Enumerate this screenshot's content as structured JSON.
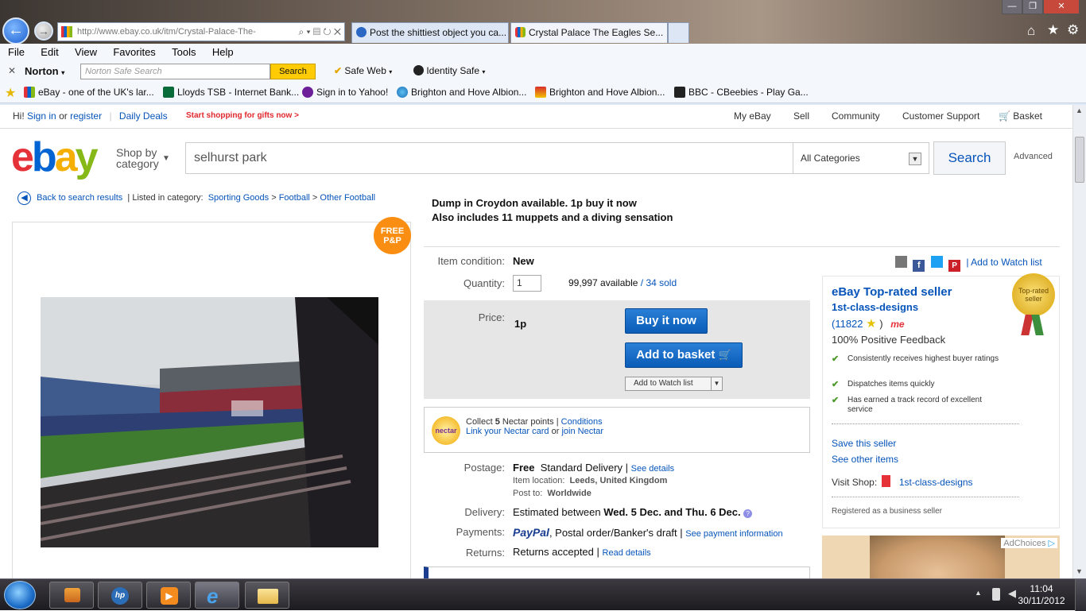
{
  "browser": {
    "address": "http://www.ebay.co.uk/itm/Crystal-Palace-The-",
    "tabs": [
      {
        "title": "Post the shittiest object you ca..."
      },
      {
        "title": "Crystal Palace The Eagles Se..."
      }
    ],
    "menu": [
      "File",
      "Edit",
      "View",
      "Favorites",
      "Tools",
      "Help"
    ],
    "norton": {
      "brand": "Norton",
      "search_placeholder": "Norton Safe Search",
      "search_label": "Search",
      "safe_web": "Safe Web",
      "identity_safe": "Identity Safe"
    },
    "favorites": [
      "eBay - one of the UK's lar...",
      "Lloyds TSB - Internet Bank...",
      "Sign in to Yahoo!",
      "Brighton and Hove Albion...",
      "Brighton and Hove Albion...",
      "BBC - CBeebies - Play Ga..."
    ]
  },
  "topbar": {
    "greeting": "Hi!",
    "sign_in": "Sign in",
    "or": "or",
    "register": "register",
    "daily_deals": "Daily Deals",
    "promo": "Start shopping for gifts now >",
    "my_ebay": "My eBay",
    "sell": "Sell",
    "community": "Community",
    "customer_support": "Customer Support",
    "basket": "Basket"
  },
  "header": {
    "shop_by": "Shop by",
    "category": "category",
    "search_value": "selhurst park",
    "all_categories": "All Categories",
    "search_button": "Search",
    "advanced": "Advanced"
  },
  "breadcrumb": {
    "back": "Back to search results",
    "listed_in": "| Listed in category:",
    "items": [
      "Sporting Goods",
      "Football",
      "Other Football"
    ]
  },
  "badge": {
    "line1": "FREE",
    "line2": "P&P"
  },
  "item": {
    "title_line1": "Dump in Croydon available. 1p buy it now",
    "title_line2": "Also includes 11 muppets and a diving sensation",
    "condition_label": "Item condition:",
    "condition": "New",
    "quantity_label": "Quantity:",
    "quantity": "1",
    "available": "99,997 available",
    "sold": "34 sold",
    "price_label": "Price:",
    "price": "1p",
    "buy_now": "Buy it now",
    "add_to_basket": "Add to basket",
    "add_watch": "Add to Watch list"
  },
  "nectar": {
    "logo": "nectar",
    "collect_prefix": "Collect",
    "points": "5",
    "collect_suffix": "Nectar points |",
    "conditions": "Conditions",
    "link_card": "Link your Nectar card",
    "or": "or",
    "join": "join Nectar"
  },
  "shipping": {
    "postage_label": "Postage:",
    "postage": "Free",
    "postage_type": "Standard Delivery |",
    "see_details": "See details",
    "item_location_label": "Item location:",
    "item_location": "Leeds, United Kingdom",
    "post_to_label": "Post to:",
    "post_to": "Worldwide",
    "delivery_label": "Delivery:",
    "delivery_prefix": "Estimated between",
    "delivery_dates": "Wed. 5 Dec. and Thu. 6 Dec.",
    "payments_label": "Payments:",
    "paypal": "PayPal",
    "payments_other": ", Postal order/Banker's draft |",
    "see_payment": "See payment information",
    "returns_label": "Returns:",
    "returns": "Returns accepted |",
    "read_details": "Read details"
  },
  "social": {
    "add_watch": "| Add to Watch list"
  },
  "seller": {
    "heading": "eBay Top-rated seller",
    "name": "1st-class-designs",
    "feedback_count": "(11822",
    "feedback_close": ")",
    "me_badge": "me",
    "positive": "100% Positive Feedback",
    "seal": "Top-rated seller",
    "checks": [
      "Consistently receives highest buyer ratings",
      "Dispatches items quickly",
      "Has earned a track record of excellent service"
    ],
    "save_seller": "Save this seller",
    "see_other": "See other items",
    "visit_shop_label": "Visit Shop:",
    "shop_name": "1st-class-designs",
    "registered": "Registered as a business seller"
  },
  "ad": {
    "adchoices": "AdChoices"
  },
  "taskbar": {
    "time": "11:04",
    "date": "30/11/2012"
  }
}
